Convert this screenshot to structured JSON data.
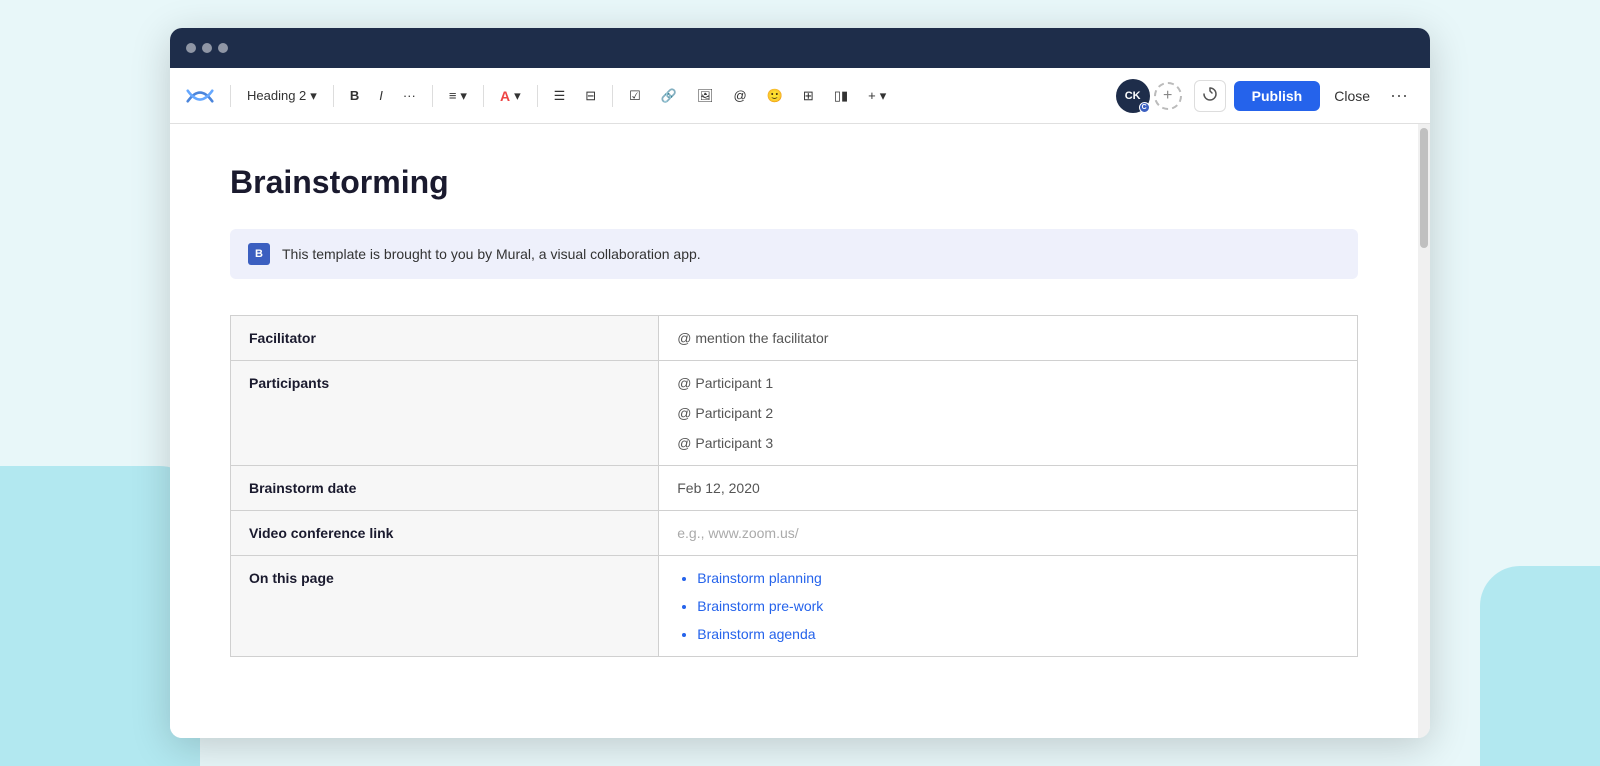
{
  "window": {
    "titlebar": {
      "dots": [
        "dot1",
        "dot2",
        "dot3"
      ]
    }
  },
  "toolbar": {
    "logo_label": "Confluence logo",
    "heading_selector": "Heading 2",
    "bold_label": "B",
    "italic_label": "I",
    "more_format_label": "···",
    "align_label": "≡",
    "align_caret": "∨",
    "font_color_label": "A",
    "font_color_caret": "∨",
    "bullet_list_label": "≡",
    "numbered_list_label": "≣",
    "task_label": "☑",
    "link_label": "🔗",
    "image_label": "🖼",
    "mention_label": "@",
    "emoji_label": "🙂",
    "table_label": "⊞",
    "more_inserts_label": "⧉",
    "insert_more_label": "+",
    "avatar_initials": "CK",
    "avatar_sub": "C",
    "add_label": "+",
    "edit_icon_label": "✎",
    "publish_label": "Publish",
    "close_label": "Close",
    "more_options_label": "···"
  },
  "editor": {
    "page_title": "Brainstorming",
    "banner": {
      "icon_label": "B",
      "text": "This template is brought to you by Mural, a visual collaboration app."
    },
    "table": {
      "rows": [
        {
          "label": "Facilitator",
          "value": "@ mention the facilitator",
          "type": "text"
        },
        {
          "label": "Participants",
          "participants": [
            "@ Participant 1",
            "@ Participant 2",
            "@ Participant 3"
          ],
          "type": "participants"
        },
        {
          "label": "Brainstorm date",
          "value": "Feb 12, 2020",
          "type": "text"
        },
        {
          "label": "Video conference link",
          "value": "e.g., www.zoom.us/",
          "type": "text"
        },
        {
          "label": "On this page",
          "links": [
            "Brainstorm planning",
            "Brainstorm pre-work",
            "Brainstorm agenda"
          ],
          "type": "links"
        }
      ]
    }
  }
}
